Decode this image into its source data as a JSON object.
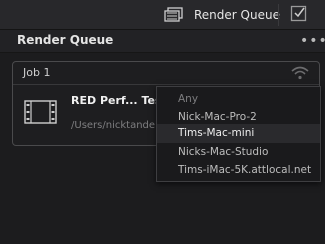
{
  "topbar": {
    "render_queue_label": "Render Queue"
  },
  "panel": {
    "title": "Render Queue",
    "menu_glyph": "•••"
  },
  "job": {
    "label": "Job 1",
    "item_title": "RED Perf... Testi",
    "item_path": "/Users/nicktande"
  },
  "dropdown": {
    "items": [
      {
        "label": "Any",
        "state": "dim"
      },
      {
        "label": "Nick-Mac-Pro-2",
        "state": "normal"
      },
      {
        "label": "Tims-Mac-mini",
        "state": "selected"
      },
      {
        "label": "Nicks-Mac-Studio",
        "state": "normal"
      },
      {
        "label": "Tims-iMac-5K.attlocal.net",
        "state": "normal"
      }
    ]
  }
}
